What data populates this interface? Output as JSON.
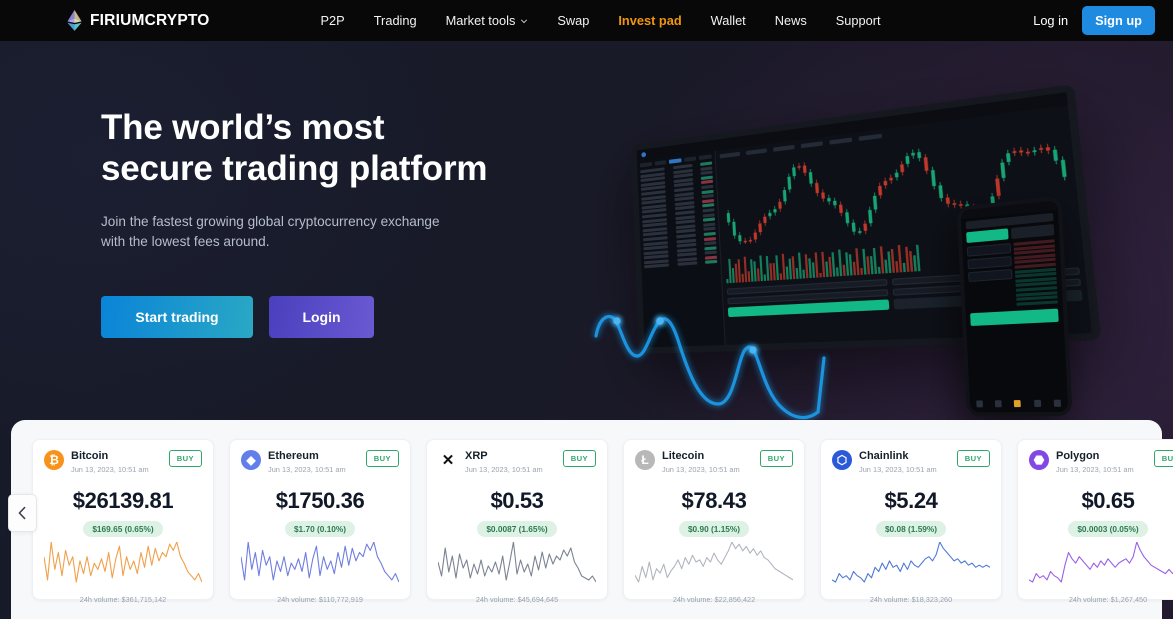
{
  "navbar": {
    "brand": "FIRIUMCRYPTO",
    "brand_icon": "ethereum-diamond-logo-icon",
    "links": [
      {
        "label": "P2P",
        "accent": false,
        "caret": false
      },
      {
        "label": "Trading",
        "accent": false,
        "caret": false
      },
      {
        "label": "Market tools",
        "accent": false,
        "caret": true
      },
      {
        "label": "Swap",
        "accent": false,
        "caret": false
      },
      {
        "label": "Invest pad",
        "accent": true,
        "caret": false
      },
      {
        "label": "Wallet",
        "accent": false,
        "caret": false
      },
      {
        "label": "News",
        "accent": false,
        "caret": false
      },
      {
        "label": "Support",
        "accent": false,
        "caret": false
      }
    ],
    "login_label": "Log in",
    "signup_label": "Sign up",
    "accent_color": "#f0960f",
    "signup_color": "#1e8ae0"
  },
  "hero": {
    "title": "The world’s most\nsecure trading platform",
    "subtitle": "Join the fastest growing global cryptocurrency exchange\nwith the lowest fees around.",
    "primary_button": "Start trading",
    "secondary_button": "Login",
    "primary_color": "#0a84d8",
    "secondary_color": "#4a3fbd",
    "wave_color": "#1e9ae8"
  },
  "ticker": {
    "prev_label": "‹",
    "buy_label": "BUY",
    "cards": [
      {
        "name": "Bitcoin",
        "symbol": "₿",
        "icon_color": "#f7931a",
        "timestamp": "Jun 13, 2023, 10:51 am",
        "price": "$26139.81",
        "change": "$169.65 (0.65%)",
        "volume": "24h volume: $361,715,142",
        "line_color": "#f0a04b",
        "spark": [
          30,
          8,
          44,
          18,
          34,
          12,
          36,
          22,
          30,
          6,
          26,
          14,
          30,
          12,
          24,
          18,
          28,
          16,
          34,
          10,
          28,
          40,
          12,
          30,
          18,
          26,
          14,
          34,
          20,
          40,
          22,
          38,
          26,
          34,
          30,
          42,
          36,
          44,
          30,
          24,
          16,
          12,
          8,
          14,
          6
        ]
      },
      {
        "name": "Ethereum",
        "symbol": "◆",
        "icon_color": "#627eea",
        "timestamp": "Jun 13, 2023, 10:51 am",
        "price": "$1750.36",
        "change": "$1.70 (0.10%)",
        "volume": "24h volume: $110,772,919",
        "line_color": "#6f7ee0",
        "spark": [
          28,
          6,
          42,
          16,
          32,
          10,
          34,
          20,
          28,
          6,
          24,
          14,
          28,
          10,
          22,
          16,
          26,
          14,
          32,
          8,
          26,
          38,
          10,
          28,
          16,
          24,
          12,
          32,
          18,
          38,
          20,
          36,
          24,
          32,
          28,
          40,
          34,
          42,
          28,
          22,
          14,
          10,
          6,
          12,
          4
        ]
      },
      {
        "name": "XRP",
        "symbol": "✕",
        "icon_color": "transparent",
        "timestamp": "Jun 13, 2023, 10:51 am",
        "price": "$0.53",
        "change": "$0.0087 (1.65%)",
        "volume": "24h volume: $45,694,645",
        "line_color": "#7b8493",
        "spark": [
          24,
          10,
          38,
          14,
          30,
          8,
          32,
          18,
          26,
          8,
          22,
          12,
          26,
          10,
          20,
          14,
          24,
          12,
          30,
          6,
          24,
          44,
          12,
          26,
          14,
          22,
          10,
          30,
          16,
          34,
          18,
          32,
          22,
          30,
          26,
          36,
          30,
          38,
          24,
          18,
          10,
          8,
          6,
          10,
          4
        ]
      },
      {
        "name": "Litecoin",
        "symbol": "Ł",
        "icon_color": "#b8b8b8",
        "timestamp": "Jun 13, 2023, 10:51 am",
        "price": "$78.43",
        "change": "$0.90 (1.15%)",
        "volume": "24h volume: $22,856,422",
        "line_color": "#b0b5be",
        "spark": [
          12,
          6,
          20,
          10,
          24,
          8,
          18,
          14,
          22,
          10,
          16,
          20,
          26,
          18,
          28,
          22,
          30,
          24,
          26,
          20,
          28,
          24,
          32,
          26,
          22,
          28,
          34,
          42,
          36,
          40,
          34,
          38,
          32,
          36,
          30,
          34,
          28,
          26,
          22,
          18,
          16,
          14,
          12,
          10,
          8
        ]
      },
      {
        "name": "Chainlink",
        "symbol": "⬡",
        "icon_color": "#2a5ada",
        "timestamp": "Jun 13, 2023, 10:51 am",
        "price": "$5.24",
        "change": "$0.08 (1.59%)",
        "volume": "24h volume: $18,323,260",
        "line_color": "#4f79d8",
        "spark": [
          8,
          6,
          14,
          10,
          12,
          8,
          16,
          12,
          10,
          6,
          14,
          10,
          20,
          16,
          24,
          18,
          26,
          20,
          22,
          16,
          24,
          18,
          26,
          22,
          20,
          24,
          28,
          30,
          26,
          32,
          44,
          38,
          34,
          30,
          26,
          28,
          24,
          26,
          22,
          24,
          20,
          22,
          20,
          22,
          20
        ]
      },
      {
        "name": "Polygon",
        "symbol": "⬣",
        "icon_color": "#8247e5",
        "timestamp": "Jun 13, 2023, 10:51 am",
        "price": "$0.65",
        "change": "$0.0003 (0.05%)",
        "volume": "24h volume: $1,267,450",
        "line_color": "#9a5fe8",
        "spark": [
          8,
          6,
          14,
          10,
          12,
          8,
          16,
          12,
          10,
          6,
          22,
          34,
          28,
          24,
          30,
          26,
          22,
          18,
          24,
          20,
          26,
          22,
          28,
          24,
          20,
          24,
          26,
          28,
          24,
          30,
          44,
          36,
          30,
          26,
          22,
          20,
          18,
          16,
          14,
          18,
          14,
          16,
          14,
          16,
          14
        ]
      }
    ]
  }
}
